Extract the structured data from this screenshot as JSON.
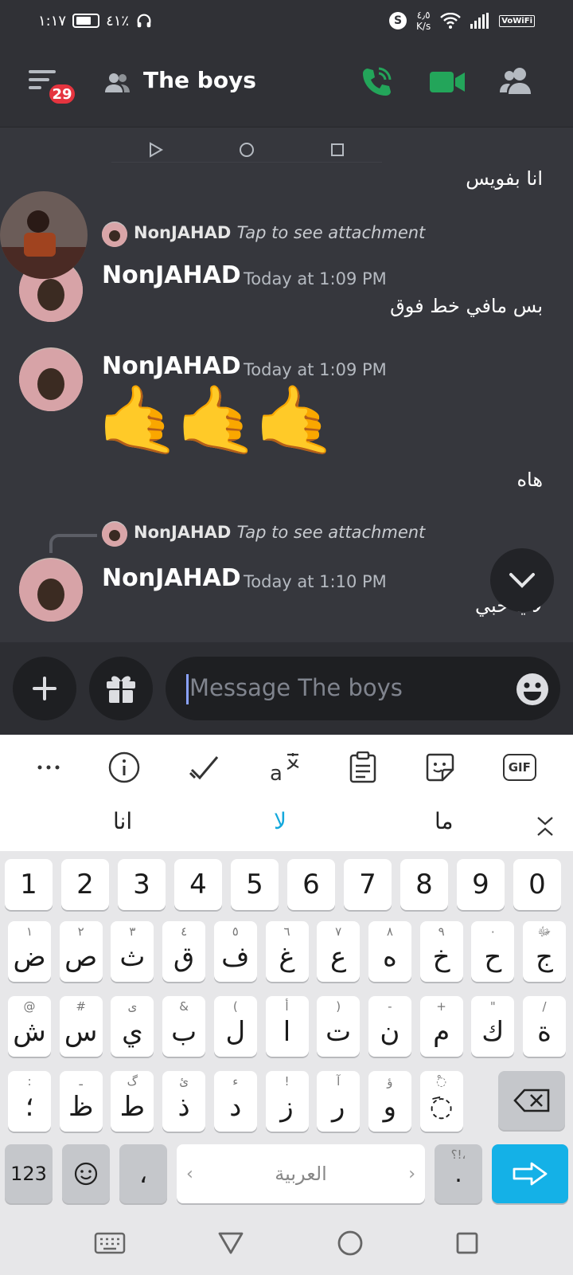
{
  "status_bar": {
    "time": "١:١٧",
    "battery_percent": "٤١٪",
    "net_speed_value": "٤٫٥",
    "net_speed_unit": "K/s",
    "vowifi": "VoWiFi"
  },
  "header": {
    "notification_count": "29",
    "title": "The boys",
    "icons": [
      "menu-icon",
      "group-icon",
      "voice-call-icon",
      "video-call-icon",
      "members-icon"
    ],
    "accent_green": "#23a55a"
  },
  "messages": {
    "msg1_text": "انا بفويس",
    "reply1": {
      "author": "NonJAHAD",
      "text": "Tap to see attachment"
    },
    "msg2": {
      "author": "NonJAHAD",
      "timestamp": "Today at 1:09 PM",
      "text": "بس مافي خط فوق"
    },
    "msg3": {
      "author": "NonJAHAD",
      "timestamp": "Today at 1:09 PM",
      "emoji": "🤙🤙🤙",
      "text": "هاه"
    },
    "reply2": {
      "author": "NonJAHAD",
      "text": "Tap to see attachment"
    },
    "msg4": {
      "author": "NonJAHAD",
      "timestamp": "Today at 1:10 PM",
      "text": "لا يا حبي"
    }
  },
  "composer": {
    "placeholder": "Message The boys"
  },
  "keyboard": {
    "toolbar": [
      "more-icon",
      "info-icon",
      "checkmark-icon",
      "translate-icon",
      "clipboard-icon",
      "sticker-icon",
      "gif-icon"
    ],
    "gif_label": "GIF",
    "suggestions": [
      "انا",
      "لا",
      "ما"
    ],
    "number_row": [
      "1",
      "2",
      "3",
      "4",
      "5",
      "6",
      "7",
      "8",
      "9",
      "0"
    ],
    "row1": [
      {
        "k": "ض",
        "s": "١"
      },
      {
        "k": "ص",
        "s": "٢"
      },
      {
        "k": "ث",
        "s": "٣"
      },
      {
        "k": "ق",
        "s": "٤"
      },
      {
        "k": "ف",
        "s": "٥"
      },
      {
        "k": "غ",
        "s": "٦"
      },
      {
        "k": "ع",
        "s": "٧"
      },
      {
        "k": "ه",
        "s": "٨"
      },
      {
        "k": "خ",
        "s": "٩"
      },
      {
        "k": "ح",
        "s": "٠"
      },
      {
        "k": "ج",
        "s": "ﷻ"
      }
    ],
    "row2": [
      {
        "k": "ش",
        "s": "@"
      },
      {
        "k": "س",
        "s": "#"
      },
      {
        "k": "ي",
        "s": "ى"
      },
      {
        "k": "ب",
        "s": "&"
      },
      {
        "k": "ل",
        "s": "("
      },
      {
        "k": "ا",
        "s": "أ"
      },
      {
        "k": "ت",
        "s": ")"
      },
      {
        "k": "ن",
        "s": "-"
      },
      {
        "k": "م",
        "s": "+"
      },
      {
        "k": "ك",
        "s": "\""
      },
      {
        "k": "ة",
        "s": "/"
      }
    ],
    "row3": [
      {
        "k": "؛",
        "s": ":"
      },
      {
        "k": "ظ",
        "s": "ـ"
      },
      {
        "k": "ط",
        "s": "گ"
      },
      {
        "k": "ذ",
        "s": "ئ"
      },
      {
        "k": "د",
        "s": "ء"
      },
      {
        "k": "ز",
        "s": "!"
      },
      {
        "k": "ر",
        "s": "آ"
      },
      {
        "k": "و",
        "s": "ؤ"
      },
      {
        "k": "◌َ",
        "s": "◌ْ"
      }
    ],
    "key_123": "123",
    "comma": "،",
    "space_label": "العربية",
    "period": ".",
    "period_sub": "؟!،",
    "enter_color": "#14b1e7"
  }
}
